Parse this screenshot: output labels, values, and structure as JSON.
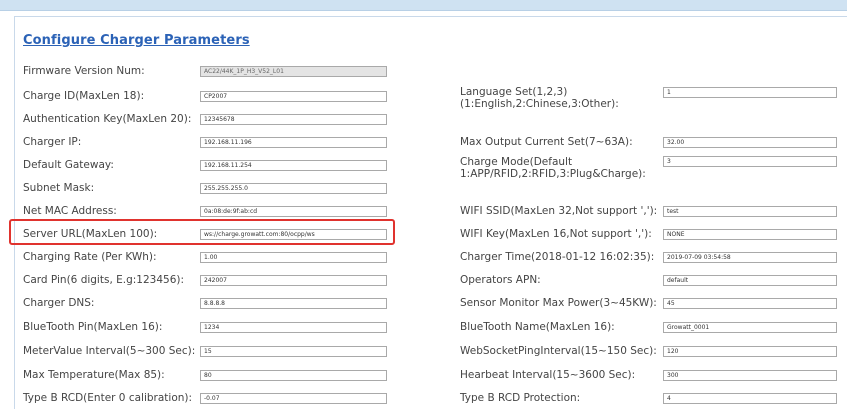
{
  "title": "Configure Charger Parameters",
  "left_fields": [
    {
      "label": "Firmware Version Num:",
      "value": "AC22/44K_1P_H3_V52_L01"
    },
    {
      "label": "Charge ID(MaxLen 18):",
      "value": "CP2007"
    },
    {
      "label": "Authentication Key(MaxLen 20):",
      "value": "12345678"
    },
    {
      "label": "Charger IP:",
      "value": "192.168.11.196"
    },
    {
      "label": "Default Gateway:",
      "value": "192.168.11.254"
    },
    {
      "label": "Subnet Mask:",
      "value": "255.255.255.0"
    },
    {
      "label": "Net MAC Address:",
      "value": "0a:08:de:9f:ab:cd"
    },
    {
      "label": "Server URL(MaxLen 100):",
      "value": "ws://charge.growatt.com:80/ocpp/ws"
    },
    {
      "label": "Charging Rate (Per KWh):",
      "value": "1.00"
    },
    {
      "label": "Card Pin(6 digits, E.g:123456):",
      "value": "242007"
    },
    {
      "label": "Charger DNS:",
      "value": "8.8.8.8"
    },
    {
      "label": "BlueTooth Pin(MaxLen 16):",
      "value": "1234"
    },
    {
      "label": "MeterValue Interval(5~300 Sec):",
      "value": "15"
    },
    {
      "label": "Max Temperature(Max 85):",
      "value": "80"
    },
    {
      "label": "Type B RCD(Enter 0 calibration):",
      "value": "-0.07"
    }
  ],
  "right_fields": [
    {
      "label": "Language Set(1,2,3)\n(1:English,2:Chinese,3:Other):",
      "value": "1"
    },
    {
      "label": "Max Output Current Set(7~63A):",
      "value": "32.00"
    },
    {
      "label": "Charge Mode(Default\n1:APP/RFID,2:RFID,3:Plug&Charge):",
      "value": "3"
    },
    {
      "label": "WIFI SSID(MaxLen 32,Not support ','):",
      "value": "test"
    },
    {
      "label": "WIFI Key(MaxLen 16,Not support ','):",
      "value": "NONE"
    },
    {
      "label": "Charger Time(2018-01-12 16:02:35):",
      "value": "2019-07-09 03:54:58"
    },
    {
      "label": "Operators APN:",
      "value": "default"
    },
    {
      "label": "Sensor Monitor Max Power(3~45KW):",
      "value": "45"
    },
    {
      "label": "BlueTooth Name(MaxLen 16):",
      "value": "Growatt_0001"
    },
    {
      "label": "WebSocketPingInterval(15~150 Sec):",
      "value": "120"
    },
    {
      "label": "Hearbeat Interval(15~3600 Sec):",
      "value": "300"
    },
    {
      "label": "Type B RCD Protection:",
      "value": "4"
    }
  ]
}
